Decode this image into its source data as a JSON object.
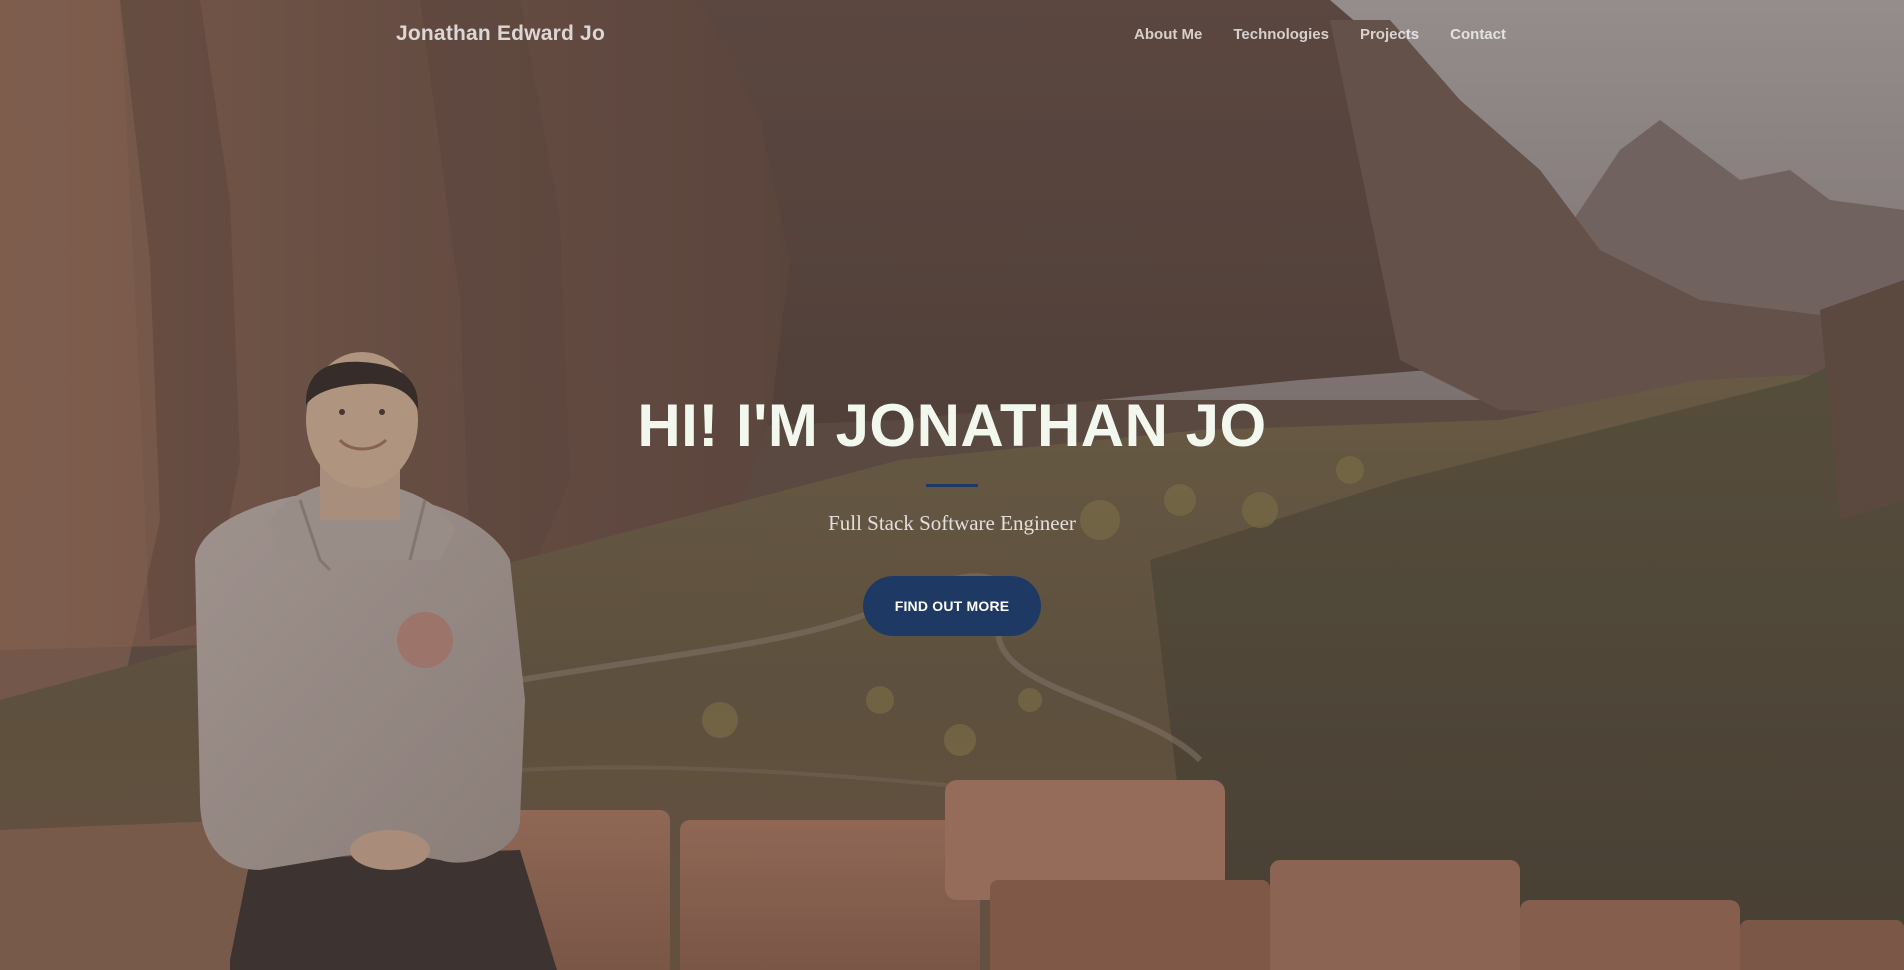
{
  "navbar": {
    "brand": "Jonathan Edward Jo",
    "links": [
      "About Me",
      "Technologies",
      "Projects",
      "Contact"
    ]
  },
  "hero": {
    "title": "HI! I'M JONATHAN JO",
    "subtitle": "Full Stack Software Engineer",
    "cta_label": "FIND OUT MORE",
    "background_image": "canyon-portrait-photo"
  },
  "colors": {
    "accent": "#1e3a64",
    "title_text": "#f3f8ef",
    "overlay": "#5c4a42"
  }
}
